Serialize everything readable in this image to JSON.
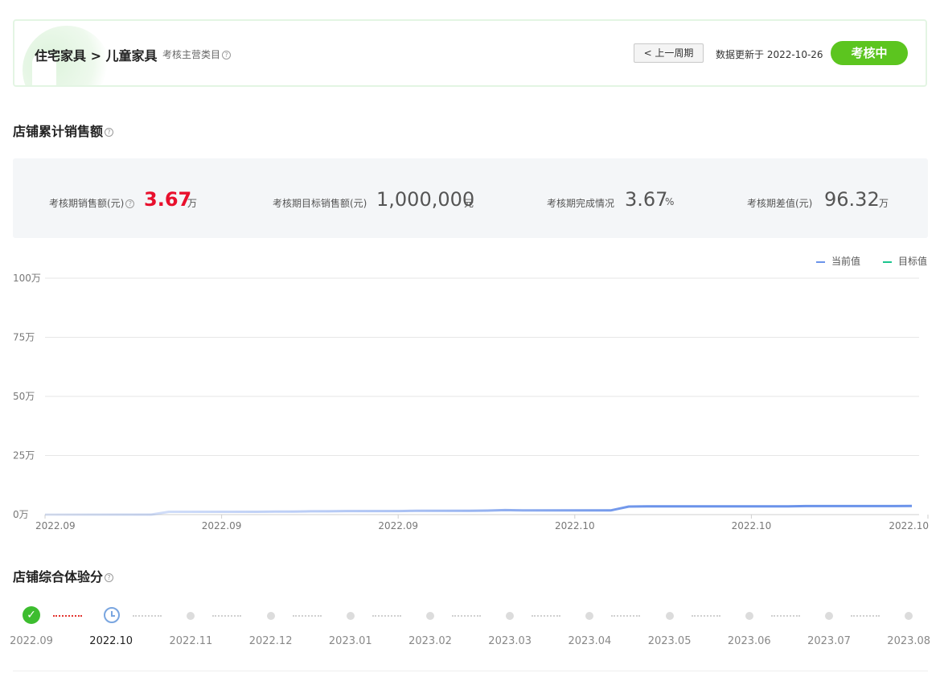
{
  "header": {
    "breadcrumb": "住宅家具 > 儿童家具",
    "sub_label": "考核主营类目",
    "prev_button": "< 上一周期",
    "update_text": "数据更新于 2022-10-26",
    "status": "考核中",
    "status_color": "#5cc51f"
  },
  "sales_section": {
    "title": "店铺累计销售额",
    "stats": [
      {
        "label": "考核期销售额(元)",
        "value": "3.67",
        "unit": "万"
      },
      {
        "label": "考核期目标销售额(元)",
        "value": "1,000,000",
        "unit": "元"
      },
      {
        "label": "考核期完成情况",
        "value": "3.67",
        "unit": "%"
      },
      {
        "label": "考核期差值(元)",
        "value": "96.32",
        "unit": "万"
      }
    ],
    "highlight_color": "#e8102d"
  },
  "chart_data": {
    "type": "line",
    "y_ticks": [
      "0万",
      "25万",
      "50万",
      "75万",
      "100万"
    ],
    "ylim": [
      0,
      100
    ],
    "x_tick_labels": [
      "2022.09",
      "2022.09",
      "2022.09",
      "2022.10",
      "2022.10",
      "2022.10"
    ],
    "grid": true,
    "legend_position": "top-right",
    "series": [
      {
        "name": "当前值",
        "color": "#6b93ea",
        "values": [
          0,
          0,
          0,
          0,
          0,
          0,
          0,
          1.2,
          1.2,
          1.2,
          1.2,
          1.2,
          1.2,
          1.3,
          1.3,
          1.4,
          1.4,
          1.5,
          1.5,
          1.5,
          1.5,
          1.6,
          1.6,
          1.6,
          1.6,
          1.7,
          1.9,
          1.8,
          1.8,
          1.8,
          1.8,
          1.8,
          1.8,
          3.4,
          3.5,
          3.5,
          3.5,
          3.5,
          3.5,
          3.5,
          3.5,
          3.5,
          3.5,
          3.6,
          3.6,
          3.6,
          3.6,
          3.6,
          3.6,
          3.67
        ]
      },
      {
        "name": "目标值",
        "color": "#1bc58e",
        "values": [
          100,
          100,
          100,
          100,
          100,
          100,
          100,
          100,
          100,
          100,
          100,
          100,
          100,
          100,
          100,
          100,
          100,
          100,
          100,
          100,
          100,
          100,
          100,
          100,
          100,
          100,
          100,
          100,
          100,
          100,
          100,
          100,
          100,
          100,
          100,
          100,
          100,
          100,
          100,
          100,
          100,
          100,
          100,
          100,
          100,
          100,
          100,
          100,
          100,
          100
        ]
      }
    ]
  },
  "experience_section": {
    "title": "店铺综合体验分",
    "months": [
      "2022.09",
      "2022.10",
      "2022.11",
      "2022.12",
      "2023.01",
      "2023.02",
      "2023.03",
      "2023.04",
      "2023.05",
      "2023.06",
      "2023.07",
      "2023.08"
    ],
    "done_icon": "check-icon",
    "current_icon": "clock-icon"
  }
}
